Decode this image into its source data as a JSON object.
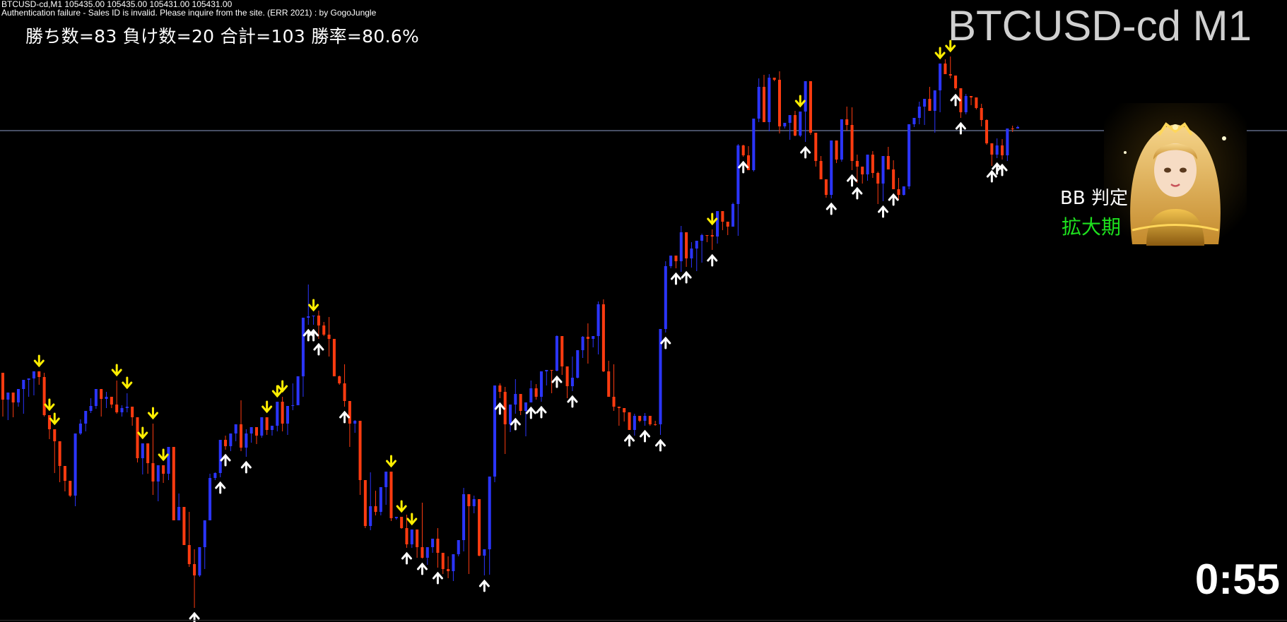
{
  "header": {
    "quote_line": "BTCUSD-cd,M1  105435.00 105435.00 105431.00 105431.00",
    "error_line": "Authentication failure - Sales ID is invalid. Please inquire from the site. (ERR 2021) : by GogoJungle"
  },
  "stats": {
    "text": "勝ち数=83  負け数=20  合計=103  勝率=80.6%"
  },
  "symbol": {
    "title": "BTCUSD-cd M1"
  },
  "indicator": {
    "label": "BB 判定",
    "state": "拡大期"
  },
  "timer": {
    "value": "0:55"
  },
  "colors": {
    "up": "#2b35ff",
    "down": "#ff3b10",
    "up_arrow": "#ffffff",
    "down_arrow": "#ffee00",
    "hline": "#8c9cc8",
    "state": "#1ee01e"
  },
  "chart_data": {
    "type": "candlestick",
    "symbol": "BTCUSD-cd",
    "timeframe": "M1",
    "current_price_line": 105431.0,
    "candles": [
      [
        528,
        582,
        566,
        590
      ],
      [
        566,
        586,
        556,
        595
      ],
      [
        556,
        585,
        570,
        591
      ],
      [
        570,
        570,
        551,
        576
      ],
      [
        551,
        575,
        538,
        586
      ],
      [
        538,
        555,
        536,
        562
      ],
      [
        536,
        533,
        526,
        560
      ],
      [
        526,
        532,
        534,
        545
      ],
      [
        534,
        528,
        588,
        590
      ],
      [
        588,
        612,
        608,
        622
      ],
      [
        608,
        660,
        625,
        670
      ],
      [
        625,
        675,
        660,
        683
      ],
      [
        660,
        690,
        681,
        696
      ],
      [
        681,
        695,
        702,
        704
      ],
      [
        702,
        690,
        614,
        717
      ],
      [
        614,
        594,
        600,
        616
      ],
      [
        600,
        598,
        582,
        611
      ],
      [
        582,
        564,
        575,
        585
      ],
      [
        575,
        568,
        551,
        579
      ],
      [
        551,
        584,
        565,
        590
      ],
      [
        565,
        555,
        562,
        578
      ],
      [
        562,
        567,
        573,
        578
      ],
      [
        573,
        539,
        584,
        586
      ],
      [
        584,
        574,
        578,
        590
      ],
      [
        578,
        557,
        576,
        584
      ],
      [
        576,
        581,
        591,
        603
      ],
      [
        591,
        593,
        649,
        655
      ],
      [
        649,
        652,
        628,
        672
      ],
      [
        628,
        636,
        656,
        671
      ],
      [
        656,
        600,
        682,
        701
      ],
      [
        682,
        695,
        659,
        710
      ],
      [
        659,
        661,
        671,
        684
      ],
      [
        671,
        675,
        633,
        680
      ],
      [
        633,
        682,
        737,
        737
      ],
      [
        737,
        699,
        718,
        737
      ],
      [
        718,
        721,
        772,
        772
      ],
      [
        772,
        725,
        799,
        803
      ],
      [
        799,
        778,
        815,
        861
      ],
      [
        815,
        786,
        775,
        817
      ],
      [
        775,
        799,
        737,
        806
      ],
      [
        737,
        671,
        677,
        717
      ],
      [
        677,
        669,
        670,
        680
      ],
      [
        670,
        628,
        623,
        676
      ],
      [
        623,
        617,
        632,
        637
      ],
      [
        632,
        632,
        614,
        639
      ],
      [
        614,
        609,
        601,
        625
      ],
      [
        601,
        567,
        634,
        639
      ],
      [
        634,
        608,
        614,
        647
      ],
      [
        614,
        621,
        605,
        627
      ],
      [
        605,
        614,
        617,
        629
      ],
      [
        617,
        607,
        591,
        620
      ],
      [
        591,
        597,
        609,
        616
      ],
      [
        609,
        611,
        603,
        617
      ],
      [
        603,
        581,
        569,
        611
      ],
      [
        569,
        562,
        600,
        611
      ],
      [
        600,
        580,
        575,
        616
      ],
      [
        575,
        543,
        574,
        581
      ],
      [
        574,
        547,
        533,
        574
      ],
      [
        533,
        561,
        450,
        562
      ],
      [
        450,
        403,
        448,
        460
      ],
      [
        448,
        458,
        447,
        460
      ],
      [
        447,
        440,
        461,
        480
      ],
      [
        461,
        456,
        474,
        476
      ],
      [
        474,
        449,
        480,
        505
      ],
      [
        480,
        508,
        533,
        533
      ],
      [
        533,
        532,
        543,
        545
      ],
      [
        543,
        516,
        568,
        576
      ],
      [
        568,
        589,
        600,
        633
      ],
      [
        600,
        595,
        596,
        613
      ],
      [
        596,
        597,
        680,
        701
      ],
      [
        680,
        690,
        745,
        748
      ],
      [
        745,
        669,
        717,
        751
      ],
      [
        717,
        695,
        725,
        730
      ],
      [
        725,
        700,
        690,
        730
      ],
      [
        690,
        708,
        668,
        715
      ],
      [
        668,
        718,
        734,
        738
      ],
      [
        734,
        732,
        732,
        736
      ],
      [
        732,
        744,
        748,
        749
      ],
      [
        748,
        729,
        771,
        776
      ],
      [
        771,
        764,
        750,
        776
      ],
      [
        750,
        752,
        775,
        790
      ],
      [
        775,
        712,
        790,
        791
      ],
      [
        790,
        793,
        775,
        800
      ],
      [
        775,
        771,
        763,
        783
      ],
      [
        763,
        748,
        783,
        804
      ],
      [
        783,
        790,
        806,
        813
      ],
      [
        806,
        788,
        809,
        819
      ],
      [
        809,
        785,
        785,
        823
      ],
      [
        785,
        786,
        765,
        788
      ],
      [
        765,
        691,
        700,
        781
      ],
      [
        700,
        735,
        717,
        813
      ],
      [
        717,
        702,
        707,
        727
      ],
      [
        707,
        707,
        787,
        788
      ],
      [
        787,
        780,
        778,
        815
      ],
      [
        778,
        779,
        675,
        814
      ],
      [
        675,
        582,
        546,
        683
      ],
      [
        546,
        543,
        555,
        564
      ],
      [
        555,
        548,
        601,
        643
      ],
      [
        601,
        609,
        573,
        612
      ],
      [
        573,
        537,
        558,
        586
      ],
      [
        558,
        571,
        582,
        588
      ],
      [
        582,
        603,
        570,
        618
      ],
      [
        570,
        539,
        550,
        568
      ],
      [
        550,
        544,
        562,
        566
      ],
      [
        562,
        543,
        526,
        569
      ],
      [
        526,
        535,
        524,
        546
      ],
      [
        524,
        535,
        525,
        557
      ],
      [
        525,
        475,
        476,
        526
      ],
      [
        476,
        485,
        519,
        531
      ],
      [
        519,
        519,
        547,
        564
      ],
      [
        547,
        505,
        535,
        554
      ],
      [
        535,
        505,
        496,
        536
      ],
      [
        496,
        476,
        477,
        507
      ],
      [
        477,
        458,
        480,
        515
      ],
      [
        480,
        489,
        476,
        492
      ],
      [
        476,
        427,
        431,
        502
      ],
      [
        431,
        424,
        526,
        527
      ],
      [
        526,
        511,
        562,
        558
      ],
      [
        562,
        516,
        576,
        582
      ],
      [
        576,
        603,
        578,
        602
      ],
      [
        578,
        590,
        584,
        597
      ],
      [
        584,
        597,
        609,
        591
      ],
      [
        609,
        617,
        589,
        586
      ],
      [
        589,
        590,
        596,
        598
      ],
      [
        596,
        585,
        589,
        603
      ],
      [
        589,
        592,
        601,
        603
      ],
      [
        601,
        596,
        601,
        603
      ],
      [
        601,
        536,
        466,
        616
      ],
      [
        466,
        370,
        377,
        471
      ],
      [
        377,
        373,
        362,
        380
      ],
      [
        362,
        366,
        370,
        380
      ],
      [
        370,
        320,
        329,
        385
      ],
      [
        329,
        345,
        366,
        378
      ],
      [
        366,
        343,
        352,
        379
      ],
      [
        352,
        351,
        341,
        384
      ],
      [
        341,
        331,
        333,
        372
      ],
      [
        333,
        337,
        333,
        343
      ],
      [
        333,
        325,
        335,
        354
      ],
      [
        335,
        305,
        299,
        345
      ],
      [
        299,
        309,
        314,
        326
      ],
      [
        314,
        320,
        321,
        333
      ],
      [
        321,
        287,
        289,
        321
      ],
      [
        289,
        204,
        206,
        334
      ],
      [
        206,
        205,
        220,
        222
      ],
      [
        220,
        207,
        241,
        227
      ],
      [
        241,
        181,
        168,
        243
      ],
      [
        168,
        111,
        123,
        173
      ],
      [
        123,
        106,
        173,
        173
      ],
      [
        173,
        105,
        110,
        186
      ],
      [
        110,
        112,
        113,
        115
      ],
      [
        113,
        101,
        179,
        189
      ],
      [
        179,
        176,
        174,
        182
      ],
      [
        174,
        193,
        163,
        198
      ],
      [
        163,
        157,
        192,
        193
      ],
      [
        192,
        186,
        158,
        194
      ],
      [
        158,
        117,
        115,
        201
      ],
      [
        115,
        120,
        188,
        191
      ],
      [
        188,
        210,
        228,
        236
      ],
      [
        228,
        221,
        254,
        252
      ],
      [
        254,
        255,
        276,
        280
      ],
      [
        276,
        269,
        199,
        281
      ],
      [
        199,
        205,
        226,
        231
      ],
      [
        226,
        208,
        169,
        229
      ],
      [
        169,
        151,
        177,
        185
      ],
      [
        177,
        152,
        228,
        241
      ],
      [
        228,
        219,
        236,
        259
      ],
      [
        236,
        248,
        247,
        260
      ],
      [
        247,
        252,
        219,
        256
      ],
      [
        219,
        214,
        245,
        252
      ],
      [
        245,
        243,
        260,
        289
      ],
      [
        260,
        244,
        221,
        285
      ],
      [
        221,
        208,
        240,
        240
      ],
      [
        240,
        227,
        268,
        246
      ],
      [
        268,
        252,
        276,
        283
      ],
      [
        276,
        265,
        264,
        277
      ],
      [
        264,
        240,
        176,
        268
      ],
      [
        176,
        173,
        167,
        180
      ],
      [
        167,
        144,
        151,
        176
      ],
      [
        151,
        143,
        140,
        177
      ],
      [
        140,
        123,
        157,
        156
      ],
      [
        157,
        129,
        128,
        188
      ],
      [
        128,
        100,
        90,
        159
      ],
      [
        90,
        84,
        105,
        95
      ],
      [
        105,
        80,
        107,
        111
      ],
      [
        107,
        120,
        125,
        127
      ],
      [
        125,
        139,
        159,
        167
      ],
      [
        159,
        133,
        136,
        162
      ],
      [
        136,
        149,
        138,
        149
      ],
      [
        138,
        146,
        153,
        155
      ],
      [
        153,
        147,
        170,
        179
      ],
      [
        170,
        169,
        203,
        205
      ],
      [
        203,
        219,
        219,
        235
      ],
      [
        219,
        196,
        206,
        224
      ],
      [
        206,
        197,
        220,
        226
      ],
      [
        220,
        214,
        182,
        228
      ],
      [
        182,
        178,
        182,
        187
      ],
      [
        182,
        178,
        180,
        181
      ]
    ],
    "buy_signals_at": [
      37,
      42,
      43,
      47,
      59,
      60,
      61,
      66,
      78,
      81,
      84,
      93,
      96,
      99,
      102,
      104,
      107,
      110,
      121,
      124,
      127,
      128,
      130,
      132,
      137,
      143,
      155,
      160,
      164,
      165,
      170,
      172,
      184,
      185,
      191,
      192,
      193,
      197,
      202,
      207
    ],
    "sell_signals_at": [
      7,
      9,
      10,
      22,
      24,
      27,
      29,
      31,
      51,
      53,
      54,
      60,
      75,
      77,
      79,
      137,
      154,
      181,
      183
    ]
  }
}
